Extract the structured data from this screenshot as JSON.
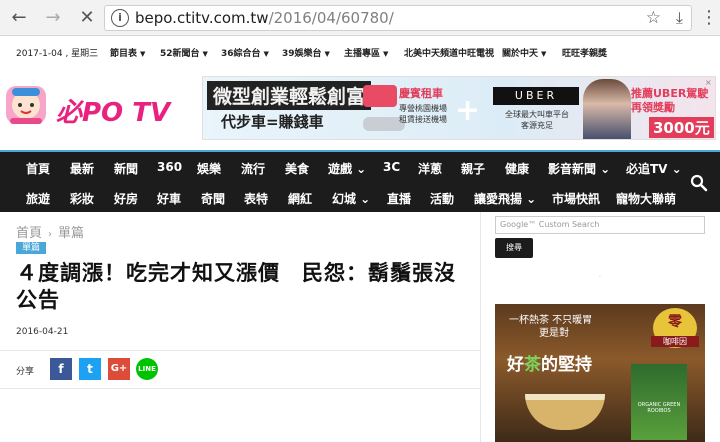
{
  "browser": {
    "url_host": "bepo.ctitv.com.tw",
    "url_path": "/2016/04/60780/",
    "back_icon": "arrow-left-icon",
    "forward_icon": "arrow-right-icon",
    "stop_icon": "close-icon"
  },
  "topbar": {
    "date": "2017-1-04 , 星期三",
    "links": [
      "節目表",
      "52新聞台",
      "36綜合台",
      "39娛樂台",
      "主播專區",
      "北美中天頻道中旺電視",
      "關於中天",
      "旺旺孝親獎"
    ]
  },
  "logo": {
    "text": "必PO TV"
  },
  "banner": {
    "line1": "微型創業輕鬆創富",
    "line2": "代步車=賺錢車",
    "partner": "慶賓租車",
    "partner_sub1": "專營桃園機場",
    "partner_sub2": "租賃接送機場",
    "plus": "+",
    "uber": "UBER",
    "uber_sub1": "全球最大叫車平台",
    "uber_sub2": "客源充足",
    "promo1": "推薦UBER駕駛",
    "promo2": "再領獎勵",
    "price": "3000元"
  },
  "nav": {
    "row1": [
      "首頁",
      "最新",
      "新聞",
      "360",
      "娛樂",
      "流行",
      "美食",
      "遊戲 ⌄",
      "3C",
      "洋蔥",
      "親子",
      "健康",
      "影音新聞 ⌄",
      "必追TV ⌄"
    ],
    "row2": [
      "旅遊",
      "彩妝",
      "好房",
      "好車",
      "奇聞",
      "表特",
      "網紅",
      "幻城 ⌄",
      "直播",
      "活動",
      "讓愛飛揚 ⌄",
      "市場快訊",
      "寵物大聯萌"
    ]
  },
  "article": {
    "breadcrumb_home": "首頁",
    "breadcrumb_sep": "›",
    "breadcrumb_current": "單篇",
    "category": "單篇",
    "title": "４度調漲！吃完才知又漲價　民怨：鬍鬚張沒公告",
    "date": "2016-04-21",
    "share_label": "分享",
    "share_fb": "f",
    "share_tw": "t",
    "share_gp": "G+",
    "share_line": "LINE"
  },
  "sidebar": {
    "search_placeholder": "Google™ Custom Search",
    "search_button": "搜尋",
    "ad_line1": "一杯熱茶 不只暖胃",
    "ad_line2": "更是對",
    "ad_headline_pre": "好",
    "ad_headline_green": "茶",
    "ad_headline_post": "的堅持",
    "ad_badge": "零",
    "ad_badge_sub": "咖啡因",
    "ad_box_label": "ORGANIC GREEN ROOIBOS"
  }
}
